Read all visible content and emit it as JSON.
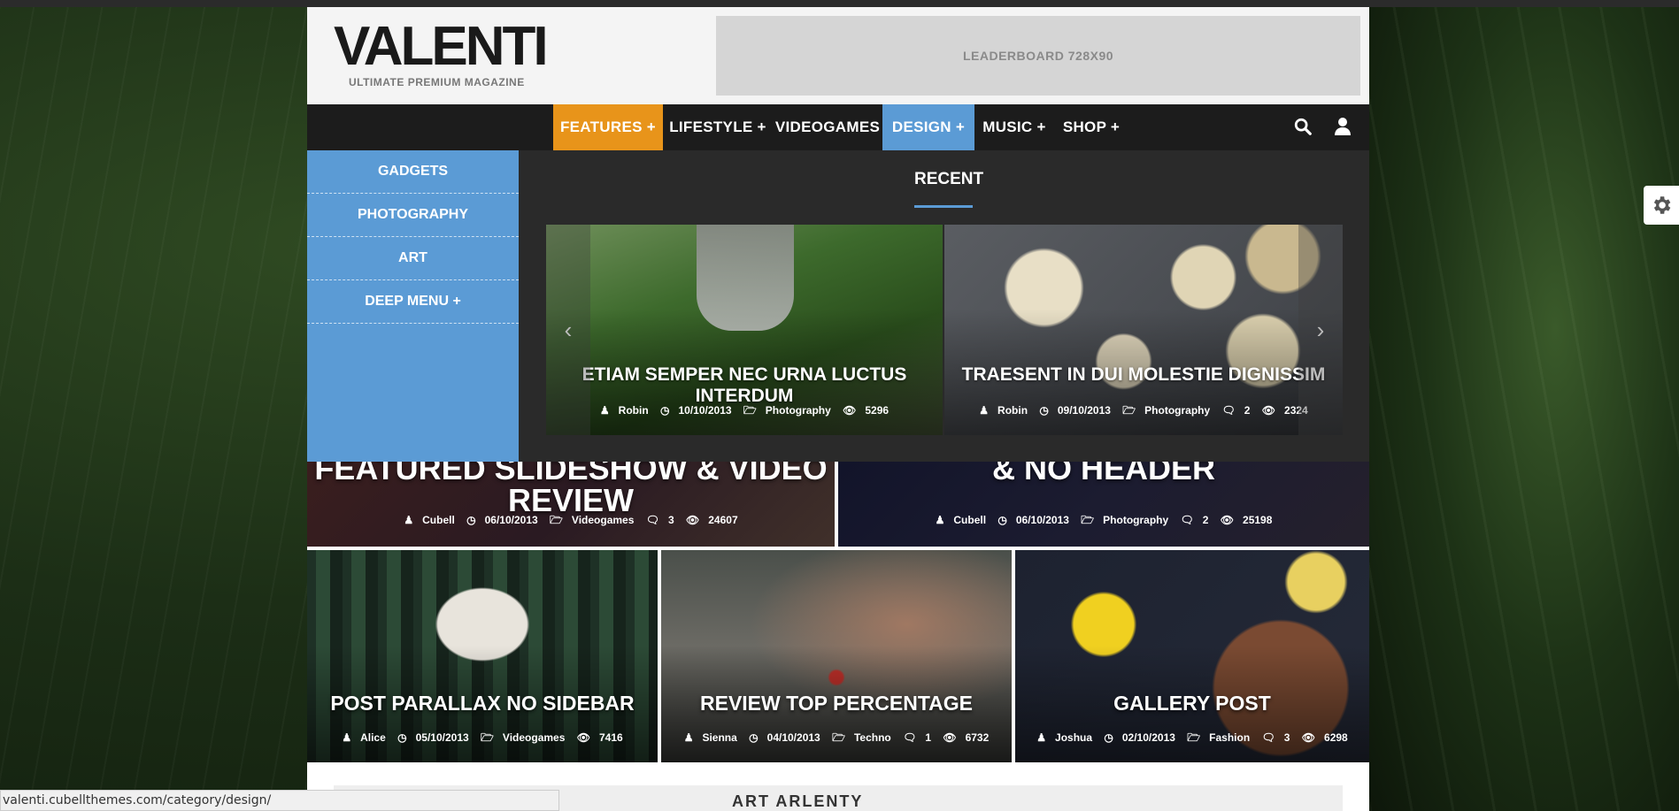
{
  "logo": {
    "main": "VALENTI",
    "sub": "ULTIMATE PREMIUM MAGAZINE"
  },
  "ad": {
    "label": "LEADERBOARD 728X90"
  },
  "nav": {
    "items": [
      {
        "label": "FEATURES +",
        "state": "active",
        "color": "#e8941a"
      },
      {
        "label": "LIFESTYLE +"
      },
      {
        "label": "VIDEOGAMES"
      },
      {
        "label": "DESIGN +",
        "state": "hover",
        "color": "#5b9bd5"
      },
      {
        "label": "MUSIC +"
      },
      {
        "label": "SHOP +"
      }
    ],
    "icons": [
      "search-icon",
      "user-icon"
    ]
  },
  "mega": {
    "side_items": [
      {
        "label": "GADGETS"
      },
      {
        "label": "PHOTOGRAPHY"
      },
      {
        "label": "ART"
      },
      {
        "label": "DEEP MENU +"
      }
    ],
    "heading": "RECENT",
    "cards": [
      {
        "title": "ETIAM SEMPER NEC URNA LUCTUS INTERDUM",
        "author": "Robin",
        "date": "10/10/2013",
        "category": "Photography",
        "views": "5296"
      },
      {
        "title": "TRAESENT IN DUI MOLESTIE DIGNISSIM",
        "author": "Robin",
        "date": "09/10/2013",
        "category": "Photography",
        "comments": "2",
        "views": "2324"
      }
    ]
  },
  "featured": [
    {
      "title": "FEATURED SLIDESHOW & VIDEO REVIEW",
      "author": "Cubell",
      "date": "06/10/2013",
      "category": "Videogames",
      "comments": "3",
      "views": "24607"
    },
    {
      "title": "& NO HEADER",
      "author": "Cubell",
      "date": "06/10/2013",
      "category": "Photography",
      "comments": "2",
      "views": "25198"
    }
  ],
  "grid": [
    {
      "title": "POST PARALLAX NO SIDEBAR",
      "author": "Alice",
      "date": "05/10/2013",
      "category": "Videogames",
      "views": "7416"
    },
    {
      "title": "REVIEW TOP PERCENTAGE",
      "author": "Sienna",
      "date": "04/10/2013",
      "category": "Techno",
      "comments": "1",
      "views": "6732"
    },
    {
      "title": "GALLERY POST",
      "author": "Joshua",
      "date": "02/10/2013",
      "category": "Fashion",
      "comments": "3",
      "views": "6298"
    }
  ],
  "below": {
    "title": "ART ARLENTY"
  },
  "statusbar": {
    "url": "valenti.cubellthemes.com/category/design/"
  },
  "colors": {
    "accent_orange": "#e8941a",
    "accent_blue": "#5b9bd5",
    "nav_bg": "#1c1c1c"
  }
}
